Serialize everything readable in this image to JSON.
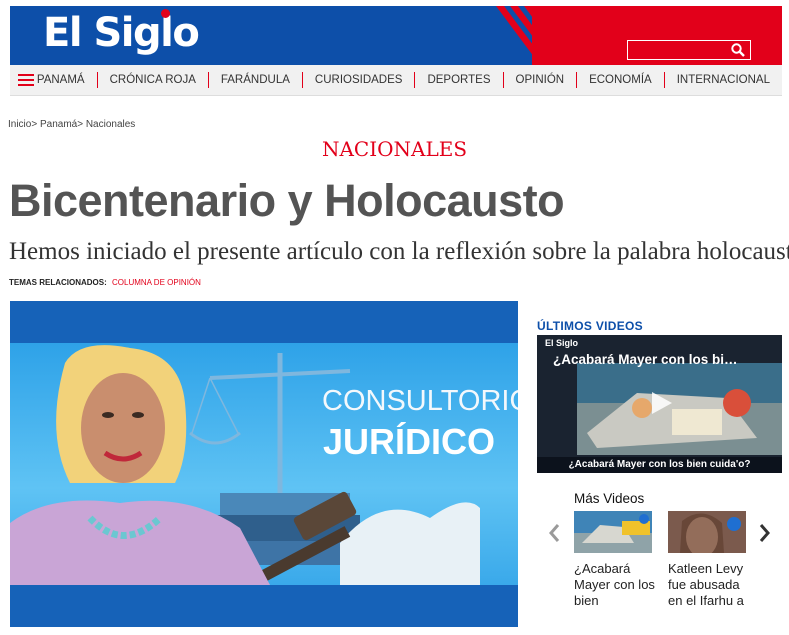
{
  "brand": {
    "name": "El Siglo"
  },
  "nav": {
    "items": [
      "PANAMÁ",
      "CRÓNICA ROJA",
      "FARÁNDULA",
      "CURIOSIDADES",
      "DEPORTES",
      "OPINIÓN",
      "ECONOMÍA",
      "INTERNACIONAL"
    ]
  },
  "breadcrumb": "Inicio> Panamá> Nacionales",
  "article": {
    "section": "NACIONALES",
    "title": "Bicentenario y Holocausto",
    "subtitle": "Hemos iniciado el presente artículo con la reflexión sobre la palabra holocausto",
    "tags_label": "TEMAS RELACIONADOS:",
    "tags_value": "COLUMNA DE OPINIÓN"
  },
  "hero": {
    "line1": "CONSULTORIO",
    "line2": "JURÍDICO"
  },
  "sidebar": {
    "title": "ÚLTIMOS VIDEOS",
    "video": {
      "logo": "El Siglo",
      "title": "¿Acabará Mayer con los bi…",
      "caption": "¿Acabará Mayer con los bien cuida'o?"
    },
    "more_label": "Más Videos",
    "more_videos": [
      {
        "title": "¿Acabará Mayer con los bien"
      },
      {
        "title": "Katleen Levy fue abusada en el Ifarhu a"
      }
    ]
  },
  "colors": {
    "brand_blue": "#0d4fa9",
    "brand_red": "#e2001a",
    "headline_gray": "#545454"
  },
  "icons": {
    "menu": "hamburger-icon",
    "search": "magnifier-icon",
    "play": "play-icon",
    "prev": "chevron-left-icon",
    "next": "chevron-right-icon"
  }
}
